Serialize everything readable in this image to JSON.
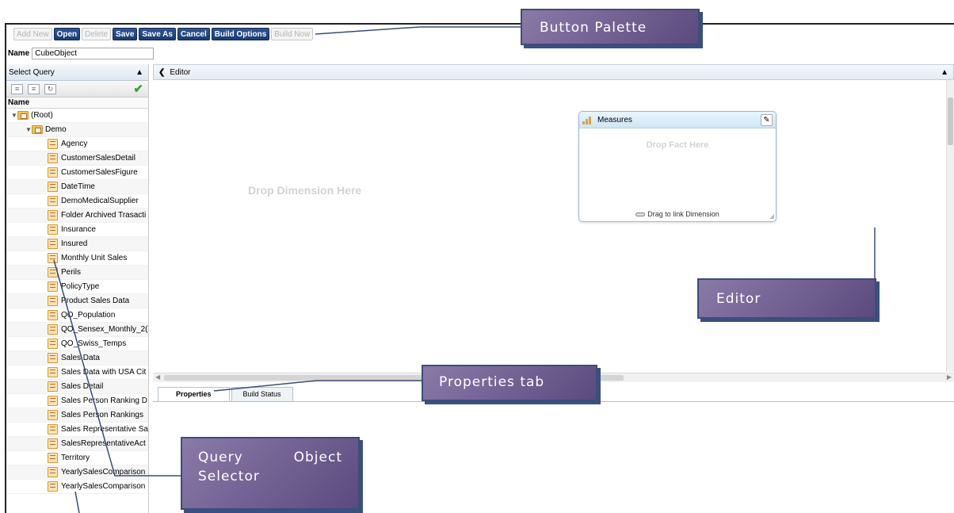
{
  "toolbar": {
    "buttons": [
      {
        "label": "Add New",
        "enabled": false
      },
      {
        "label": "Open",
        "enabled": true
      },
      {
        "label": "Delete",
        "enabled": false
      },
      {
        "label": "Save",
        "enabled": true
      },
      {
        "label": "Save As",
        "enabled": true
      },
      {
        "label": "Cancel",
        "enabled": true
      },
      {
        "label": "Build Options",
        "enabled": true
      },
      {
        "label": "Build Now",
        "enabled": false
      }
    ]
  },
  "name_field": {
    "label": "Name",
    "value": "CubeObject"
  },
  "select_query": {
    "title": "Select Query",
    "column_header": "Name",
    "root": "(Root)",
    "folder": "Demo",
    "items": [
      "Agency",
      "CustomerSalesDetail",
      "CustomerSalesFigure",
      "DateTime",
      "DemoMedicalSupplier",
      "Folder Archived Trasacti",
      "Insurance",
      "Insured",
      "Monthly Unit Sales",
      "Perils",
      "PolicyType",
      "Product Sales Data",
      "QO_Population",
      "QO_Sensex_Monthly_2(",
      "QO_Swiss_Temps",
      "Sales Data",
      "Sales Data with USA Cit",
      "Sales Detail",
      "Sales Person Ranking D",
      "Sales Person Rankings",
      "Sales Representative Sa",
      "SalesRepresentativeAct",
      "Territory",
      "YearlySalesComparison",
      "YearlySalesComparison"
    ]
  },
  "editor": {
    "title": "Editor",
    "drop_dimension": "Drop Dimension Here",
    "measures": {
      "title": "Measures",
      "drop_fact": "Drop Fact Here",
      "drag_link": "Drag to link Dimension"
    }
  },
  "tabs": [
    {
      "label": "Properties",
      "active": true
    },
    {
      "label": "Build Status",
      "active": false
    }
  ],
  "callouts": {
    "button_palette": "Button Palette",
    "editor": "Editor",
    "properties_tab": "Properties tab",
    "query_selector_word1": "Query",
    "query_selector_word2": "Object",
    "query_selector_word3": "Selector"
  },
  "colors": {
    "callout_fill": "#7a6a9a",
    "callout_border": "#3a4e79",
    "enabled_button": "#1f3f78"
  }
}
